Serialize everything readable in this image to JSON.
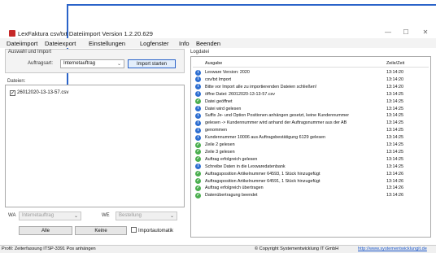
{
  "window": {
    "title": "LexFaktura csv/txt Dateiimport Version 1.2.20.629",
    "minimize_glyph": "—",
    "maximize_glyph": "☐",
    "close_glyph": "✕"
  },
  "menu": [
    "Dateiimport",
    "Dateiexport",
    "Einstellungen",
    "Logfenster",
    "Info",
    "Beenden"
  ],
  "import_group": {
    "title": "Auswahl und Import",
    "type_label": "Auftragsart:",
    "type_value": "Internetauftrag",
    "start_button": "Import starten"
  },
  "files": {
    "title": "Dateien:",
    "items": [
      {
        "checked": true,
        "name": "26012020-13-13-57.csv"
      }
    ]
  },
  "bottom_controls": {
    "wa_label": "WA",
    "wa_value": "Internetauftrag",
    "we_label": "WE",
    "we_value": "Bestellung",
    "all_button": "Alle",
    "none_button": "Keine",
    "auto_label": "Importautomatik"
  },
  "log": {
    "title": "Logdatei",
    "col_output": "Ausgabe",
    "col_time": "Zeile/Zeit",
    "rows": [
      {
        "icon": "info",
        "text": "Lexware Version: 2020",
        "time": "13:14:20"
      },
      {
        "icon": "info",
        "text": "csv/txt Import",
        "time": "13:14:20"
      },
      {
        "icon": "info",
        "text": "Bitte vor Import alle zu importierenden Dateien schließen!",
        "time": "13:14:20"
      },
      {
        "icon": "info",
        "text": "öffne Datei: 26012020-13-13-57.csv",
        "time": "13:14:25"
      },
      {
        "icon": "ok",
        "text": "Datei geöffnet",
        "time": "13:14:25"
      },
      {
        "icon": "info",
        "text": "Datei wird gelesen",
        "time": "13:14:25"
      },
      {
        "icon": "info",
        "text": "Suffix Je- und Option Positionen anhängen gesetzt, keine Kundennummer",
        "time": "13:14:25"
      },
      {
        "icon": "info",
        "text": "gelesen -> Kundennummer wird anhand der Auftragsnummer aus der AB",
        "time": "13:14:25"
      },
      {
        "icon": "info",
        "text": "genommen",
        "time": "13:14:25"
      },
      {
        "icon": "info",
        "text": "Kundennummer 10006 aus Auftragsbestätigung 6129 gelesen",
        "time": "13:14:25"
      },
      {
        "icon": "ok",
        "text": "Zeile 2 gelesen",
        "time": "13:14:25"
      },
      {
        "icon": "ok",
        "text": "Zeile 3 gelesen",
        "time": "13:14:25"
      },
      {
        "icon": "ok",
        "text": "Auftrag erfolgreich gelesen",
        "time": "13:14:25"
      },
      {
        "icon": "info",
        "text": "Schreibe Daten in die Lexwaredatenbank",
        "time": "13:14:25"
      },
      {
        "icon": "ok",
        "text": "Auftragsposition Artikelnummer 64593, 1 Stück hinzugefügt",
        "time": "13:14:26"
      },
      {
        "icon": "ok",
        "text": "Auftragsposition Artikelnummer 64591, 1 Stück hinzugefügt",
        "time": "13:14:26"
      },
      {
        "icon": "ok",
        "text": "Auftrag  erfolgreich übertragen",
        "time": "13:14:26"
      },
      {
        "icon": "ok",
        "text": "Datenübertragung beendet",
        "time": "13:14:26"
      }
    ]
  },
  "status": {
    "left": "Profil: Zeiterfassung ITSP-3391 Pos anhängen",
    "copyright": "© Copyright Systementwicklung IT GmbH",
    "link": "http://www.systementwicklungit.de"
  },
  "colors": {
    "annotation_arrow": "#2a63c9",
    "info_icon": "#2e6fd1",
    "ok_icon": "#4caf50"
  }
}
